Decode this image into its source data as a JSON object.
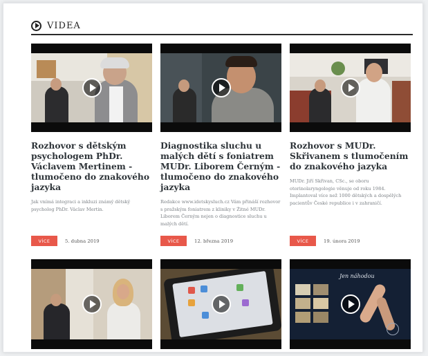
{
  "section": {
    "title": "VIDEA"
  },
  "videos": [
    {
      "title": "Rozhovor s dětským psychologem PhDr. Václavem Mertinem - tlumočeno do znakového jazyka",
      "description": "Jak vnímá integraci a inkluzi známý dětský psycholog PhDr. Václav Mertin.",
      "more_label": "VÍCE",
      "date": "5. dubna 2019"
    },
    {
      "title": "Diagnostika sluchu u malých dětí s foniatrem MUDr. Liborem Černým - tlumočeno do znakového jazyka",
      "description": "Redakce www.idetskysluch.cz Vám přináší rozhovor s pražským foniatrem z kliniky v Žitné MUDr. Liborem Černým nejen o diagnostice sluchu u malých dětí.",
      "more_label": "VÍCE",
      "date": "12. března 2019"
    },
    {
      "title": "Rozhovor s MUDr. Skřivanem s tlumočením do znakového jazyka",
      "description": "MUDr. Jiří Skřivan, CSc., se oboru otorinolaryngologie věnuje od roku 1984. Implantoval více než 1000 dětských a dospělých pacientův České republice i v zahraničí.",
      "more_label": "VÍCE",
      "date": "19. února 2019"
    }
  ],
  "thumbnail_caption": "Jen náhodou"
}
